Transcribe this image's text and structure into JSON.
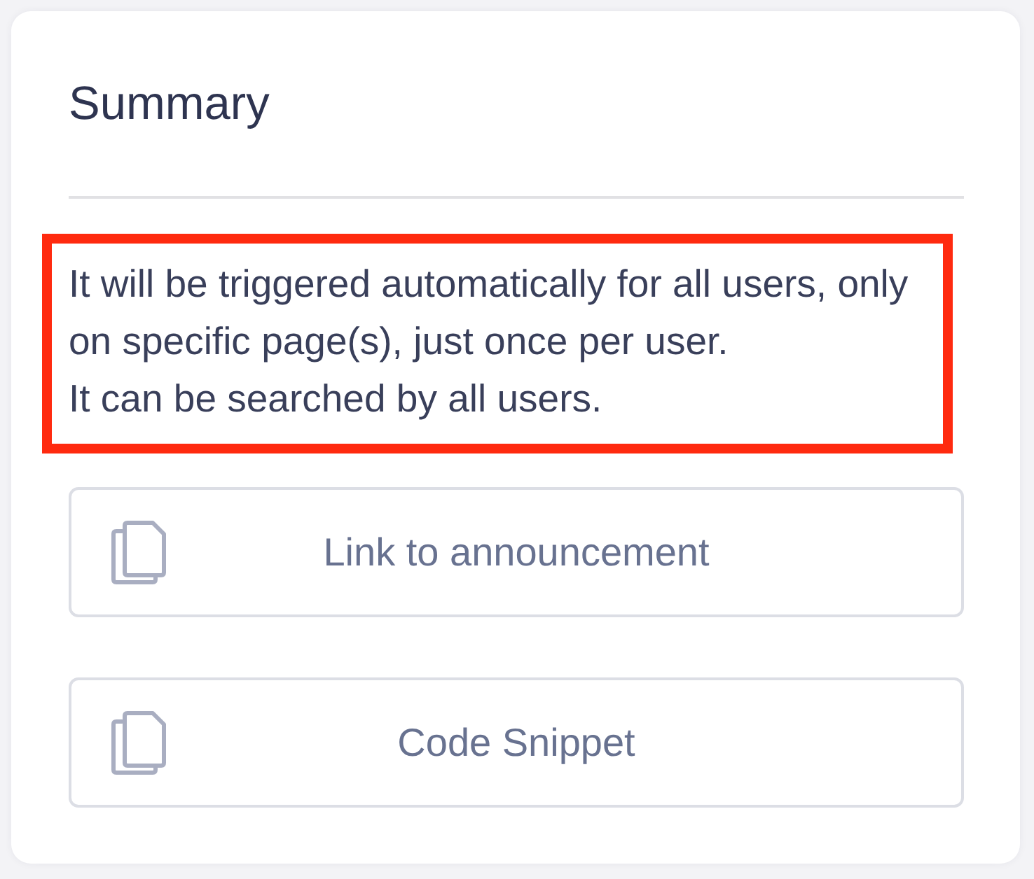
{
  "summary": {
    "title": "Summary",
    "highlighted": true,
    "paragraphs": [
      "It will be triggered automatically for all users, only on specific page(s), just once per user.",
      "It can be searched by all users."
    ]
  },
  "buttons": [
    {
      "label": "Link to announcement"
    },
    {
      "label": "Code Snippet"
    }
  ]
}
